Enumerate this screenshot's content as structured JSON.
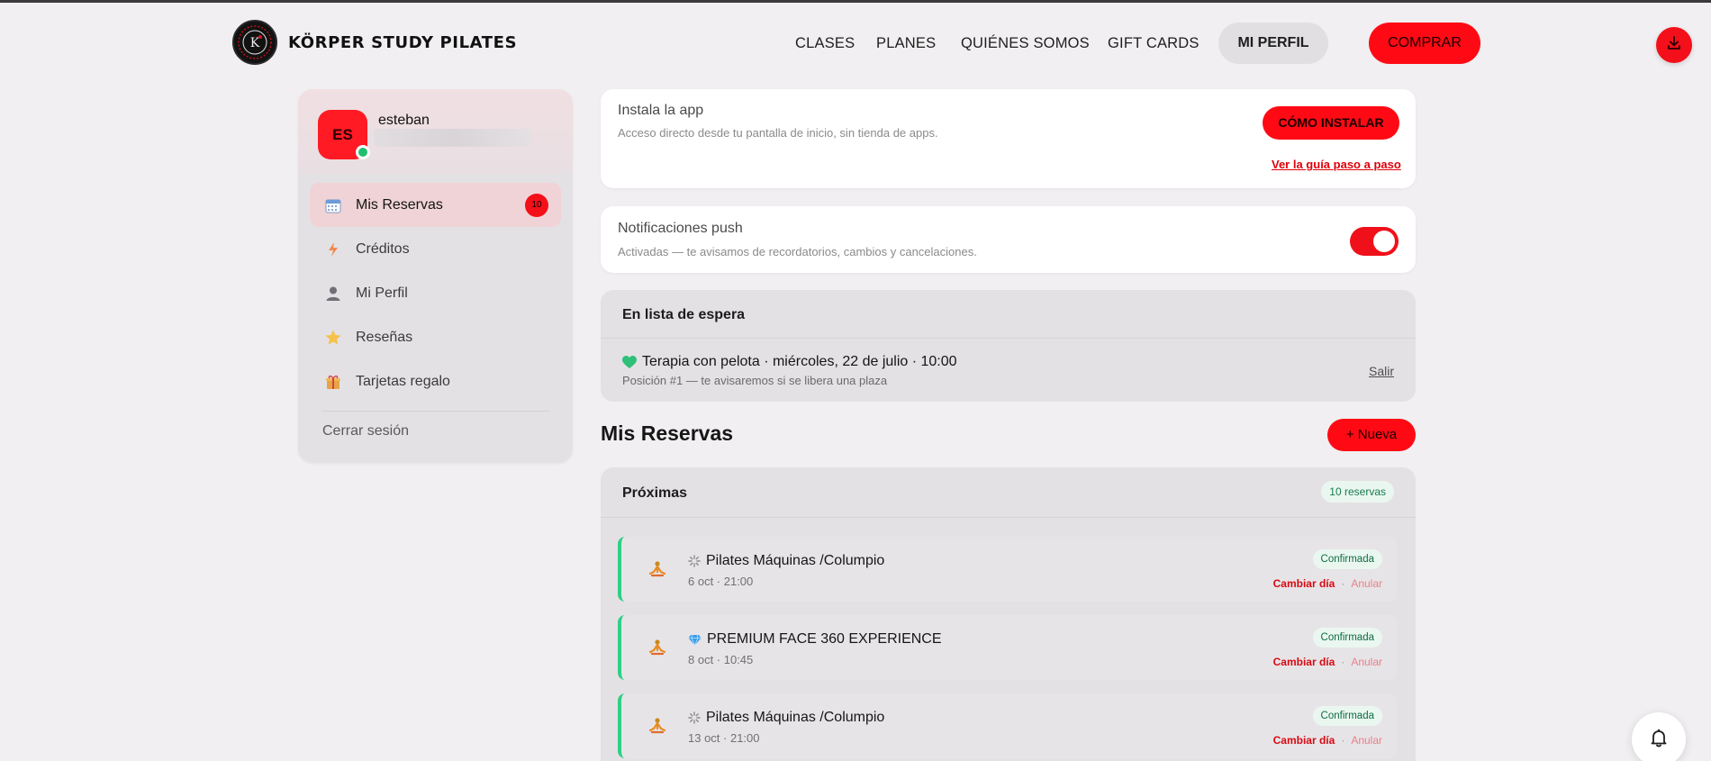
{
  "brand": {
    "name": "KÖRPER STUDY PILATES",
    "logo_icon": "korper-logo-icon"
  },
  "nav": {
    "links": [
      "CLASES",
      "PLANES",
      "QUIÉNES SOMOS",
      "GIFT CARDS"
    ],
    "profile": "MI PERFIL",
    "buy": "COMPRAR",
    "download_icon": "download-icon"
  },
  "colors": {
    "accent": "#ff0a14",
    "success": "#2ecf86",
    "background": "#f1eff1"
  },
  "sidebar": {
    "user": {
      "initials": "ES",
      "name": "esteban"
    },
    "items": [
      {
        "label": "Mis Reservas",
        "icon": "calendar-icon",
        "badge": "10",
        "active": true
      },
      {
        "label": "Créditos",
        "icon": "bolt-icon"
      },
      {
        "label": "Mi Perfil",
        "icon": "user-icon"
      },
      {
        "label": "Reseñas",
        "icon": "star-icon"
      },
      {
        "label": "Tarjetas regalo",
        "icon": "gift-icon"
      }
    ],
    "logout": "Cerrar sesión"
  },
  "install": {
    "title": "Instala la app",
    "subtitle": "Acceso directo desde tu pantalla de inicio, sin tienda de apps.",
    "button": "CÓMO INSTALAR",
    "guide_link": "Ver la guía paso a paso"
  },
  "push": {
    "title": "Notificaciones push",
    "subtitle": "Activadas — te avisamos de recordatorios, cambios y cancelaciones.",
    "enabled": true
  },
  "waitlist": {
    "title": "En lista de espera",
    "class": "Terapia con pelota · miércoles, 22 de julio · 10:00",
    "position": "Posición #1 — te avisaremos si se libera una plaza",
    "exit": "Salir"
  },
  "reservas": {
    "title": "Mis Reservas",
    "new_button": "+ Nueva",
    "upcoming_title": "Próximas",
    "count": "10 reservas",
    "items": [
      {
        "name": "Pilates Máquinas /Columpio",
        "mini_icon": "spark-icon",
        "time": "6 oct · 21:00",
        "status": "Confirmada",
        "change": "Cambiar día",
        "cancel": "Anular"
      },
      {
        "name": "PREMIUM FACE 360 EXPERIENCE",
        "mini_icon": "diamond-icon",
        "time": "8 oct · 10:45",
        "status": "Confirmada",
        "change": "Cambiar día",
        "cancel": "Anular"
      },
      {
        "name": "Pilates Máquinas /Columpio",
        "mini_icon": "spark-icon",
        "time": "13 oct · 21:00",
        "status": "Confirmada",
        "change": "Cambiar día",
        "cancel": "Anular"
      }
    ]
  },
  "bell_icon": "bell-icon"
}
